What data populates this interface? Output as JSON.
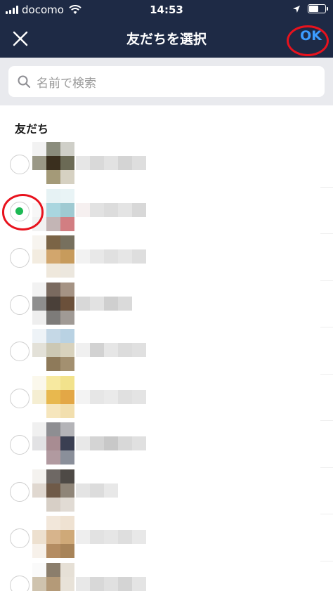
{
  "status_bar": {
    "carrier": "docomo",
    "time": "14:53",
    "battery_level": 0.6
  },
  "nav": {
    "title": "友だちを選択",
    "ok_label": "OK",
    "close_icon": "close-icon"
  },
  "search": {
    "placeholder": "名前で検索",
    "icon": "search-icon"
  },
  "section": {
    "title": "友だち"
  },
  "colors": {
    "nav_bg": "#1e2a45",
    "ok_blue": "#3c9cff",
    "check_green": "#1db954",
    "annotation_red": "#e8121d"
  },
  "friends": [
    {
      "checked": false,
      "avatar": [
        "#f2f2f2",
        "#8a8c7c",
        "#cfcfc8",
        "#9a9886",
        "#3a2f1e",
        "#6b6a55",
        "#ffffff",
        "#a49a78",
        "#d6d1c2"
      ],
      "name": [
        "#e6e6e6",
        "#d9d9d9",
        "#e2e2e2",
        "#d4d4d4",
        "#dedede"
      ]
    },
    {
      "checked": true,
      "avatar": [
        "#ffffff",
        "#e6f2f4",
        "#e9f4f6",
        "#f7f7f7",
        "#a9d6df",
        "#9fcad2",
        "#f2f2f2",
        "#c3b5b5",
        "#d27e82"
      ],
      "name": [
        "#f6f0f0",
        "#e2e2e2",
        "#dcdcdc",
        "#e4e4e4",
        "#d8d8d8"
      ]
    },
    {
      "checked": false,
      "avatar": [
        "#f7f4ef",
        "#7b6446",
        "#77705e",
        "#f3ece0",
        "#d2a66d",
        "#c79b5c",
        "#ffffff",
        "#efe8dc",
        "#ece7de"
      ],
      "name": [
        "#f2f2f2",
        "#e8e8e8",
        "#e0e0e0",
        "#e6e6e6",
        "#dedede"
      ]
    },
    {
      "checked": false,
      "avatar": [
        "#f2f2f2",
        "#7a6a5f",
        "#a59384",
        "#8e8e8e",
        "#4a4039",
        "#6b503a",
        "#eeeeee",
        "#7d7b79",
        "#a09a95"
      ],
      "name": [
        "#d8d8d8",
        "#e2e2e2",
        "#cfcfcf",
        "#dadada"
      ]
    },
    {
      "checked": false,
      "avatar": [
        "#eef3f7",
        "#c5d8e6",
        "#b9d2e3",
        "#e3e1d8",
        "#ccc8b4",
        "#d8d2bd",
        "#ffffff",
        "#8e7a5a",
        "#a39070"
      ],
      "name": [
        "#f0f0f0",
        "#d2d2d2",
        "#e6e6e6",
        "#dcdcdc",
        "#e0e0e0"
      ]
    },
    {
      "checked": false,
      "avatar": [
        "#fbf8ec",
        "#f7e9a0",
        "#f2e28c",
        "#f5eed2",
        "#e8b84e",
        "#e3a746",
        "#ffffff",
        "#f6e6bd",
        "#f2dfae"
      ],
      "name": [
        "#f3f3f3",
        "#e6e6e6",
        "#eaeaea",
        "#e0e0e0",
        "#e4e4e4"
      ]
    },
    {
      "checked": false,
      "avatar": [
        "#f0f0f0",
        "#8e8e92",
        "#b4b4b8",
        "#e2e2e4",
        "#a88c92",
        "#3a3f52",
        "#ffffff",
        "#b19aa0",
        "#8a8f9a"
      ],
      "name": [
        "#e8e8e8",
        "#d4d4d4",
        "#c8c8c8",
        "#d8d8d8",
        "#e0e0e0"
      ]
    },
    {
      "checked": false,
      "avatar": [
        "#f4f2ef",
        "#6e6864",
        "#4e4a46",
        "#e0d8d0",
        "#6f5a48",
        "#8f8578",
        "#ffffff",
        "#d7cfc6",
        "#e1dbd4"
      ],
      "name": [
        "#e4e4e4",
        "#dcdcdc",
        "#e8e8e8"
      ]
    },
    {
      "checked": false,
      "avatar": [
        "#ffffff",
        "#f2e7da",
        "#efe2d2",
        "#ede0cf",
        "#d7b48c",
        "#cfa978",
        "#f7f1ea",
        "#b48c62",
        "#a88459"
      ],
      "name": [
        "#eeeeee",
        "#e2e2e2",
        "#e6e6e6",
        "#dedede",
        "#e8e8e8"
      ]
    },
    {
      "checked": false,
      "avatar": [
        "#fafafa",
        "#8b7e6c",
        "#e6e0d6",
        "#cfc3ae",
        "#b49a78",
        "#e8e2d8",
        "#ffffff",
        "#e1d8cb",
        "#efebe4"
      ],
      "name": [
        "#e8e8e8",
        "#d8d8d8",
        "#e0e0e0",
        "#d4d4d4",
        "#e4e4e4"
      ]
    }
  ]
}
